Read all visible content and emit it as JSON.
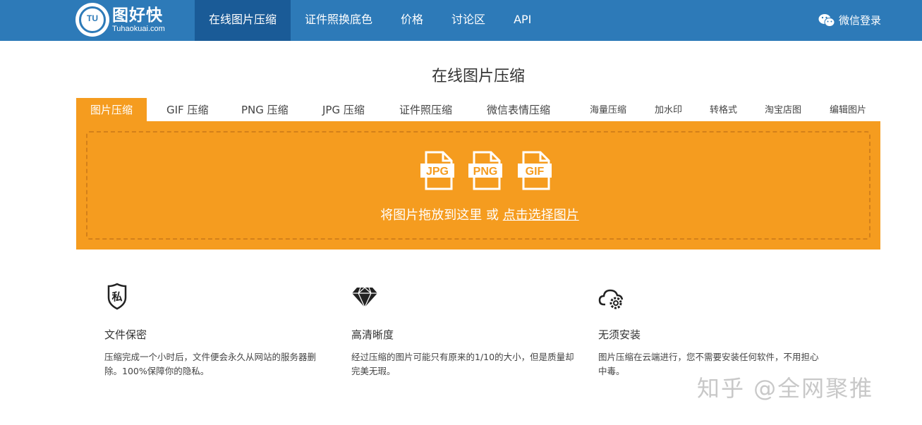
{
  "header": {
    "logo_cn": "图好快",
    "logo_en": "Tuhaokuai.com",
    "logo_mark": "TU",
    "nav": [
      "在线图片压缩",
      "证件照换底色",
      "价格",
      "讨论区",
      "API"
    ],
    "login_label": "微信登录",
    "login_icon": "wechat-icon",
    "bar_color": "#2d7ab8",
    "active_color": "#1a5b97"
  },
  "page_title": "在线图片压缩",
  "tabs": [
    "图片压缩",
    "GIF 压缩",
    "PNG 压缩",
    "JPG 压缩",
    "证件照压缩",
    "微信表情压缩",
    "海量压缩",
    "加水印",
    "转格式",
    "淘宝店图",
    "编辑图片"
  ],
  "upload": {
    "file_types": [
      "JPG",
      "PNG",
      "GIF"
    ],
    "drop_text": "将图片拖放到这里 或",
    "choose_link": "点击选择图片",
    "panel_color": "#f59c1f"
  },
  "features": [
    {
      "icon": "shield-private-icon",
      "icon_text": "私",
      "title": "文件保密",
      "desc": "压缩完成一个小时后，文件便会永久从网站的服务器删除。100%保障你的隐私。"
    },
    {
      "icon": "diamond-icon",
      "title": "高清晰度",
      "desc": "经过压缩的图片可能只有原来的1/10的大小，但是质量却完美无瑕。"
    },
    {
      "icon": "cloud-gear-icon",
      "title": "无须安装",
      "desc": "图片压缩在云端进行，您不需要安装任何软件，不用担心中毒。"
    }
  ],
  "watermark": "知乎 @全网聚推"
}
